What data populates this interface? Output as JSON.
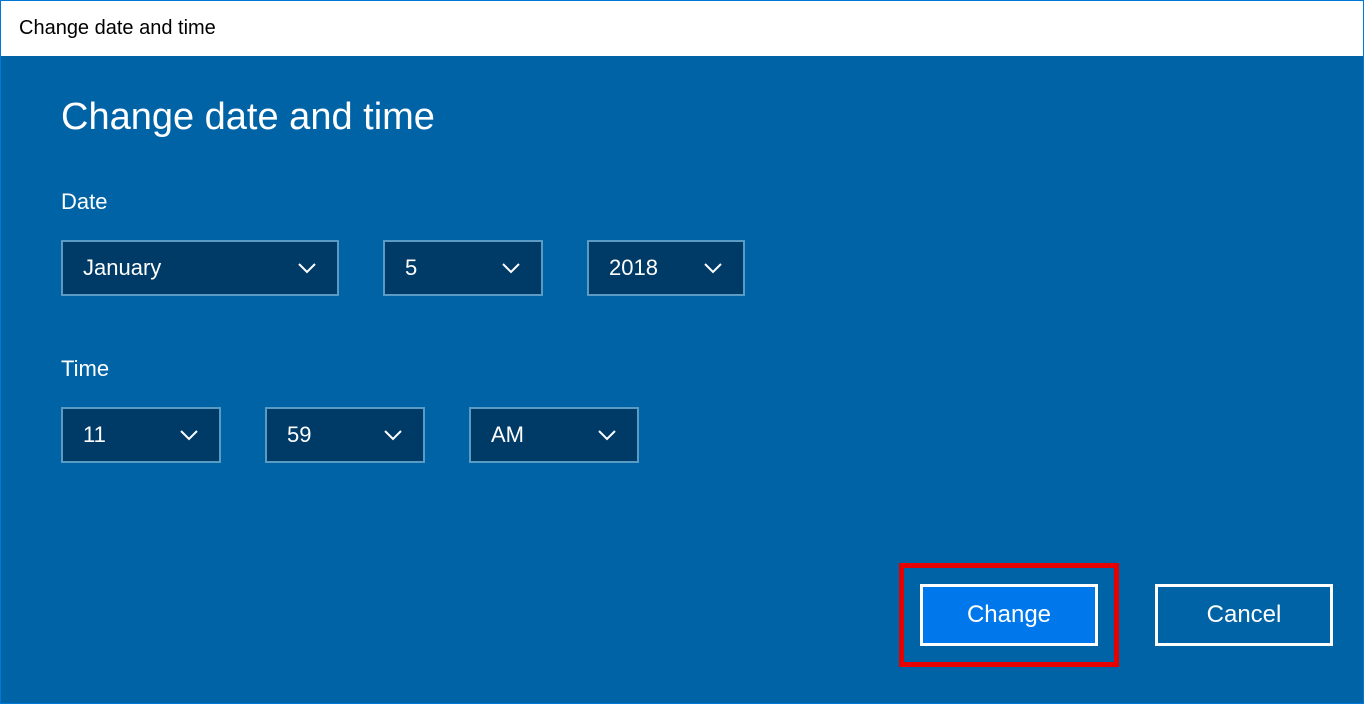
{
  "titlebar": {
    "title": "Change date and time"
  },
  "heading": "Change date and time",
  "date": {
    "label": "Date",
    "month": "January",
    "day": "5",
    "year": "2018"
  },
  "time": {
    "label": "Time",
    "hour": "11",
    "minute": "59",
    "ampm": "AM"
  },
  "buttons": {
    "change": "Change",
    "cancel": "Cancel"
  }
}
